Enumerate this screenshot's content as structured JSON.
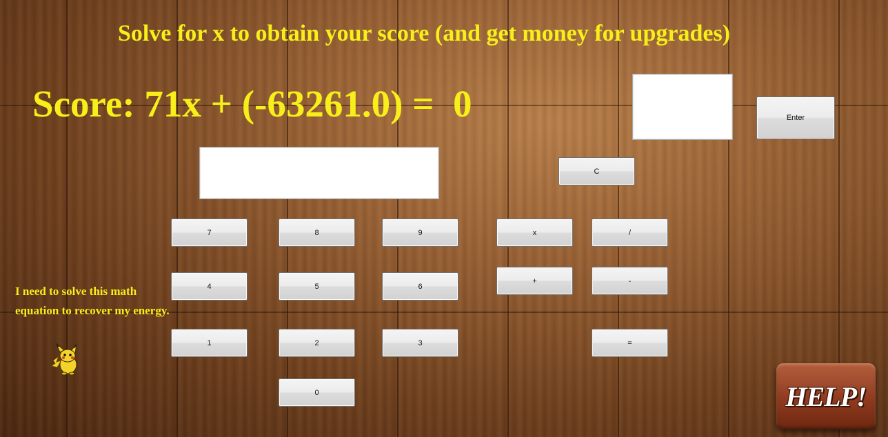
{
  "header": {
    "title": "Solve for x to obtain your score (and get money for upgrades)"
  },
  "equation": {
    "text": "Score: 71x + (-63261.0) =  0"
  },
  "answer": {
    "value": "",
    "enter_label": "Enter"
  },
  "calculator": {
    "display_value": "",
    "clear_label": "C",
    "buttons": {
      "seven": "7",
      "eight": "8",
      "nine": "9",
      "four": "4",
      "five": "5",
      "six": "6",
      "one": "1",
      "two": "2",
      "three": "3",
      "zero": "0",
      "multiply": "x",
      "divide": "/",
      "plus": "+",
      "minus": "-",
      "equals": "="
    }
  },
  "hint": {
    "text": "I need to solve this math equation to recover my energy.",
    "character_icon": "pikachu-icon"
  },
  "help": {
    "label": "HELP!"
  },
  "colors": {
    "text_yellow": "#f7ef1a",
    "wood_brown": "#8a532a",
    "help_red": "#8f3a1f"
  }
}
